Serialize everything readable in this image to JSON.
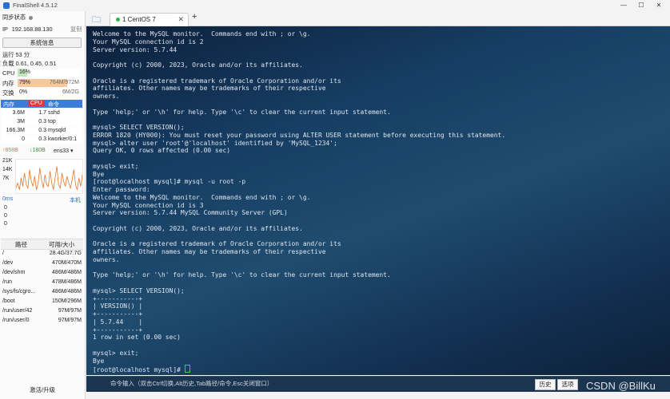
{
  "window": {
    "title": "FinalShell 4.5.12"
  },
  "sidebar": {
    "sync_status": "同步状态",
    "ip_label": "IP",
    "ip": "192.168.88.130",
    "copy": "复制",
    "sysinfo_button": "系统信息",
    "uptime": "运行 53 分",
    "load": "负载 0.61, 0.45, 0.51",
    "cpu": {
      "label": "CPU",
      "value": "16%",
      "percent": 16
    },
    "mem": {
      "label": "内存",
      "value": "79%",
      "detail": "764M/972M",
      "percent": 79
    },
    "swap": {
      "label": "交换",
      "value": "0%",
      "detail": "6M/2G",
      "percent": 0
    },
    "proc_headers": [
      "内存",
      "CPU",
      "命令"
    ],
    "processes": [
      {
        "mem": "3.6M",
        "cpu": "1.7",
        "cmd": "sshd"
      },
      {
        "mem": "3M",
        "cpu": "0.3",
        "cmd": "top"
      },
      {
        "mem": "166.3M",
        "cpu": "0.3",
        "cmd": "mysqld"
      },
      {
        "mem": "0",
        "cpu": "0.3",
        "cmd": "kworker/0:1"
      }
    ],
    "net": {
      "up": "↑858B",
      "down": "↓180B",
      "iface": "ens33",
      "scale": [
        "21K",
        "14K",
        "7K"
      ]
    },
    "ping": {
      "value": "0ms",
      "host": "本机",
      "rows": [
        "0",
        "0",
        "0"
      ]
    },
    "disk_headers": [
      "路径",
      "可用/大小"
    ],
    "disks": [
      {
        "path": "/",
        "size": "28.4G/37.7G"
      },
      {
        "path": "/dev",
        "size": "470M/470M"
      },
      {
        "path": "/dev/shm",
        "size": "486M/486M"
      },
      {
        "path": "/run",
        "size": "478M/486M"
      },
      {
        "path": "/sys/fs/cgro...",
        "size": "486M/486M"
      },
      {
        "path": "/boot",
        "size": "150M/296M"
      },
      {
        "path": "/run/user/42",
        "size": "97M/97M"
      },
      {
        "path": "/run/user/0",
        "size": "97M/97M"
      }
    ],
    "upgrade": "激活/升级"
  },
  "tabs": {
    "active": "1 CentOS 7",
    "add": "+"
  },
  "terminal": {
    "lines": [
      "Welcome to the MySQL monitor.  Commands end with ; or \\g.",
      "Your MySQL connection id is 2",
      "Server version: 5.7.44",
      "",
      "Copyright (c) 2000, 2023, Oracle and/or its affiliates.",
      "",
      "Oracle is a registered trademark of Oracle Corporation and/or its",
      "affiliates. Other names may be trademarks of their respective",
      "owners.",
      "",
      "Type 'help;' or '\\h' for help. Type '\\c' to clear the current input statement.",
      "",
      "mysql> SELECT VERSION();",
      "ERROR 1820 (HY000): You must reset your password using ALTER USER statement before executing this statement.",
      "mysql> alter user 'root'@'localhost' identified by 'MySQL_1234';",
      "Query OK, 0 rows affected (0.00 sec)",
      "",
      "mysql> exit;",
      "Bye",
      "[root@localhost mysql]# mysql -u root -p",
      "Enter password:",
      "Welcome to the MySQL monitor.  Commands end with ; or \\g.",
      "Your MySQL connection id is 3",
      "Server version: 5.7.44 MySQL Community Server (GPL)",
      "",
      "Copyright (c) 2000, 2023, Oracle and/or its affiliates.",
      "",
      "Oracle is a registered trademark of Oracle Corporation and/or its",
      "affiliates. Other names may be trademarks of their respective",
      "owners.",
      "",
      "Type 'help;' or '\\h' for help. Type '\\c' to clear the current input statement.",
      "",
      "mysql> SELECT VERSION();",
      "+-----------+",
      "| VERSION() |",
      "+-----------+",
      "| 5.7.44    |",
      "+-----------+",
      "1 row in set (0.00 sec)",
      "",
      "mysql> exit;",
      "Bye"
    ],
    "prompt": "[root@localhost mysql]# "
  },
  "cmdbar": {
    "placeholder": "命令输入（双击Ctrl切换,Alt历史,Tab路径/命令,Esc关闭窗口）",
    "history": "历史",
    "options": "选项"
  },
  "watermark": "CSDN @BillKu",
  "colors": {
    "cpu_fill": "#bfe6bf",
    "mem_fill": "#f7c89a",
    "proc_header": "#3c7dd8",
    "net_up": "#e2762b",
    "net_down": "#2f9b3d"
  },
  "net_samples": [
    3,
    6,
    2,
    9,
    4,
    12,
    5,
    3,
    14,
    7,
    4,
    10,
    2,
    6,
    15,
    8,
    3,
    11,
    5,
    4,
    13,
    6,
    2,
    9,
    16,
    5,
    3,
    12,
    7,
    4,
    10,
    6,
    3,
    8,
    14,
    5,
    2,
    9,
    4,
    11
  ]
}
